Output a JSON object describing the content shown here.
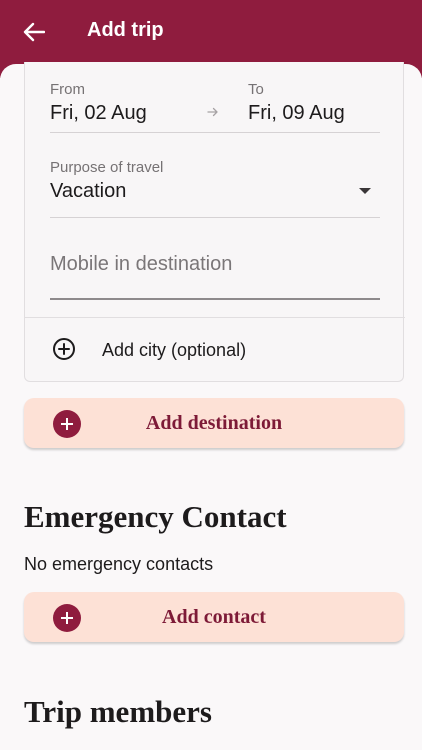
{
  "appbar": {
    "title": "Add trip",
    "back_icon": "arrow-left-icon"
  },
  "trip_form": {
    "from_label": "From",
    "from_value": "Fri, 02 Aug",
    "to_label": "To",
    "to_value": "Fri, 09 Aug",
    "purpose_label": "Purpose of travel",
    "purpose_value": "Vacation",
    "mobile_placeholder": "Mobile in destination",
    "add_city_label": "Add city (optional)"
  },
  "add_destination_label": "Add destination",
  "emergency": {
    "title": "Emergency Contact",
    "empty_text": "No emergency contacts",
    "add_label": "Add contact"
  },
  "members": {
    "title": "Trip members"
  },
  "colors": {
    "primary": "#8f1c3e",
    "button_bg": "#fde1d6",
    "button_text": "#7d1a37",
    "surface": "#faf8f9"
  }
}
